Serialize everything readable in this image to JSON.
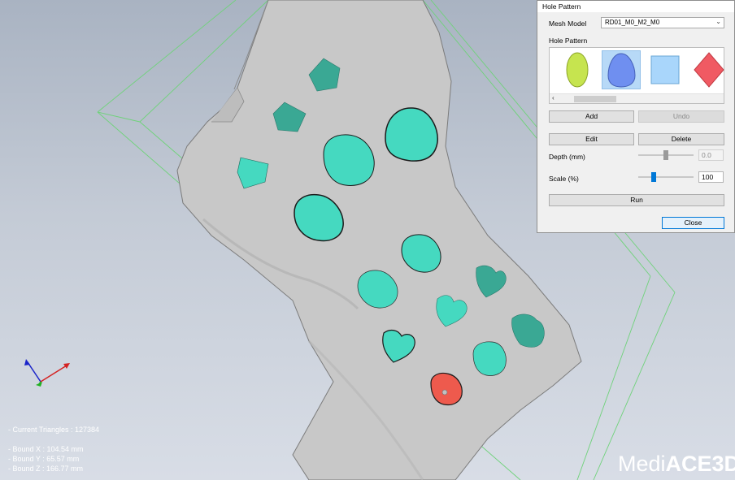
{
  "dialog": {
    "title": "Hole Pattern",
    "mesh_model_label": "Mesh Model",
    "mesh_model_value": "RD01_M0_M2_M0",
    "hole_pattern_label": "Hole Pattern",
    "patterns": [
      "ellipse",
      "egg",
      "square",
      "diamond"
    ],
    "selected_pattern": "egg",
    "add_label": "Add",
    "undo_label": "Undo",
    "edit_label": "Edit",
    "delete_label": "Delete",
    "depth_label": "Depth (mm)",
    "depth_value": "0.0",
    "scale_label": "Scale (%)",
    "scale_value": "100",
    "run_label": "Run",
    "close_label": "Close"
  },
  "stats": {
    "triangles": "- Current Triangles : 127384",
    "bound_x": "- Bound X : 104.54 mm",
    "bound_y": "- Bound Y : 65.57 mm",
    "bound_z": "- Bound Z : 166.77 mm"
  },
  "logo": {
    "part1": "Medi",
    "part2": "ACE3D"
  },
  "colors": {
    "hole": "#45d9c0",
    "hole_selected": "#ee5a4d",
    "mesh": "#c9c9c9",
    "bbox": "#6fd27a",
    "pattern_ellipse": "#c6e44f",
    "pattern_egg": "#6f8ff0",
    "pattern_square": "#a9d6fb",
    "pattern_diamond": "#f05a63"
  }
}
